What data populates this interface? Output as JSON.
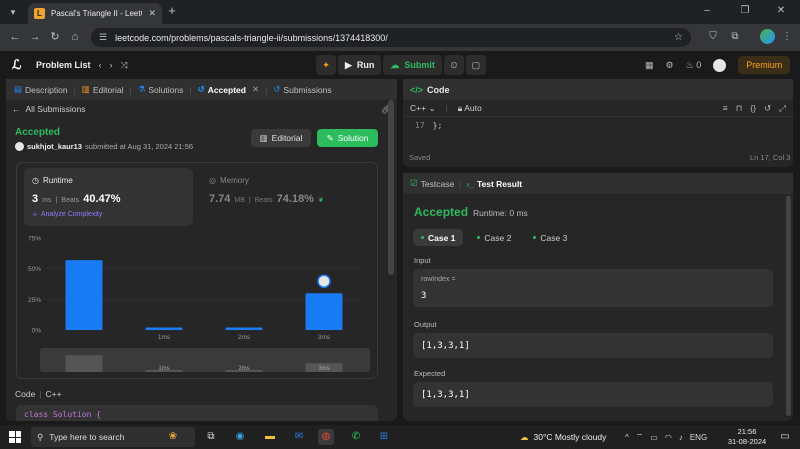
{
  "browser": {
    "tab_title": "Pascal's Triangle II - LeetCode",
    "url": "leetcode.com/problems/pascals-triangle-ii/submissions/1374418300/"
  },
  "header": {
    "problem_list": "Problem List",
    "run": "Run",
    "submit": "Submit",
    "fire_count": "0",
    "premium": "Premium"
  },
  "left": {
    "tabs": [
      "Description",
      "Editorial",
      "Solutions",
      "Accepted",
      "Submissions"
    ],
    "all_submissions": "All Submissions",
    "status": "Accepted",
    "user": "sukhjot_kaur13",
    "submitted_at": "submitted at Aug 31, 2024 21:56",
    "editorial_btn": "Editorial",
    "solution_btn": "Solution",
    "runtime_label": "Runtime",
    "runtime_value": "3",
    "runtime_unit": "ms",
    "beats_label": "Beats",
    "runtime_beats": "40.47%",
    "analyze": "Analyze Complexity",
    "memory_label": "Memory",
    "memory_value": "7.74",
    "memory_unit": "MB",
    "memory_beats": "74.18%",
    "code_label": "Code",
    "code_lang": "C++",
    "code_first_line": "class Solution {"
  },
  "chart_data": {
    "type": "bar",
    "categories": [
      "",
      "1ms",
      "2ms",
      "3ms"
    ],
    "values": [
      57,
      2,
      2,
      30
    ],
    "y_ticks": [
      "75%",
      "50%",
      "25%",
      "0%"
    ],
    "ylim": [
      0,
      75
    ],
    "highlight_index": 3,
    "bar_color": "#1a7cf5",
    "mini_labels": [
      "",
      "1ms",
      "2ms",
      "3ms"
    ]
  },
  "code": {
    "title": "Code",
    "lang": "C++",
    "mode": "Auto",
    "line_no": "17",
    "line_text": "};",
    "saved": "Saved",
    "position": "Ln 17, Col 3"
  },
  "result": {
    "testcase_tab": "Testcase",
    "result_tab": "Test Result",
    "status": "Accepted",
    "runtime": "Runtime: 0 ms",
    "cases": [
      "Case 1",
      "Case 2",
      "Case 3"
    ],
    "input_label": "Input",
    "input_param": "rowIndex =",
    "input_value": "3",
    "output_label": "Output",
    "output_value": "[1,3,3,1]",
    "expected_label": "Expected",
    "expected_value": "[1,3,3,1]"
  },
  "taskbar": {
    "search": "Type here to search",
    "weather": "30°C  Mostly cloudy",
    "lang": "ENG",
    "time": "21:56",
    "date": "31-08-2024"
  }
}
